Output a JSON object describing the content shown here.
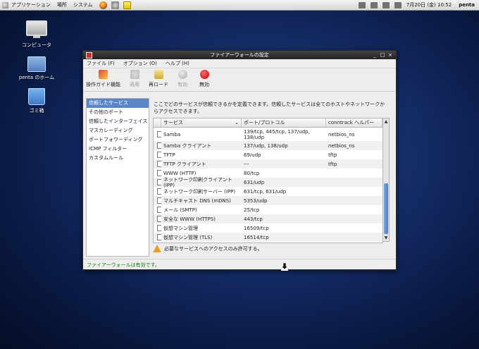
{
  "panel": {
    "menus": [
      "アプリケーション",
      "場所",
      "システム"
    ],
    "launchers": [
      "firefox-icon",
      "mail-icon",
      "notes-icon"
    ],
    "clock": "7月20日 (金) 10:52",
    "user": "penta"
  },
  "desktop": {
    "icons": [
      "コンピュータ",
      "penta のホーム",
      "ゴミ箱"
    ]
  },
  "window": {
    "title": "ファイアーウォールの設定",
    "controls": [
      "_",
      "□",
      "×"
    ],
    "menus": [
      "ファイル (F)",
      "オプション (O)",
      "ヘルプ (H)"
    ],
    "toolbar": [
      {
        "label": "操作ガイド機能",
        "icon": "wizard-icon",
        "enabled": true
      },
      {
        "label": "適用",
        "icon": "apply-icon",
        "enabled": false
      },
      {
        "label": "再ロード",
        "icon": "reload-icon",
        "enabled": true
      },
      {
        "label": "有効",
        "icon": "enable-icon",
        "enabled": false
      },
      {
        "label": "無効",
        "icon": "disable-icon",
        "enabled": true
      }
    ],
    "sidebar": [
      "信頼したサービス",
      "その他のポート",
      "信頼したインターフェイス",
      "マスカレーディング",
      "ポートフォワーディング",
      "ICMP フィルター",
      "カスタムルール"
    ],
    "description": "ここでどのサービスが信頼できるかを定義できます。信頼したサービスは全てのホストやネットワークからアクセスできます。",
    "table": {
      "headers": [
        "",
        "サービス",
        "ポート/プロトコル",
        "conntrack ヘルパー"
      ],
      "rows": [
        {
          "service": "Samba",
          "ports": "139/tcp, 445/tcp, 137/udp, 138/udp",
          "helper": "netbios_ns"
        },
        {
          "service": "Samba クライアント",
          "ports": "137/udp, 138/udp",
          "helper": "netbios_ns"
        },
        {
          "service": "TFTP",
          "ports": "69/udp",
          "helper": "tftp"
        },
        {
          "service": "TFTP クライアント",
          "ports": "---",
          "helper": "tftp"
        },
        {
          "service": "WWW (HTTP)",
          "ports": "80/tcp",
          "helper": ""
        },
        {
          "service": "ネットワーク印刷クライアント (IPP)",
          "ports": "631/udp",
          "helper": ""
        },
        {
          "service": "ネットワーク印刷サーバー (IPP)",
          "ports": "631/tcp, 631/udp",
          "helper": ""
        },
        {
          "service": "マルチキャスト DNS (mDNS)",
          "ports": "5353/udp",
          "helper": ""
        },
        {
          "service": "メール (SMTP)",
          "ports": "25/tcp",
          "helper": ""
        },
        {
          "service": "安全な WWW (HTTPS)",
          "ports": "443/tcp",
          "helper": ""
        },
        {
          "service": "仮想マシン管理",
          "ports": "16509/tcp",
          "helper": ""
        },
        {
          "service": "仮想マシン管理 (TLS)",
          "ports": "16514/tcp",
          "helper": ""
        }
      ]
    },
    "notice": "必要なサービスへのアクセスのみ許可する。",
    "status": "ファイアーウォールは有効です。"
  }
}
